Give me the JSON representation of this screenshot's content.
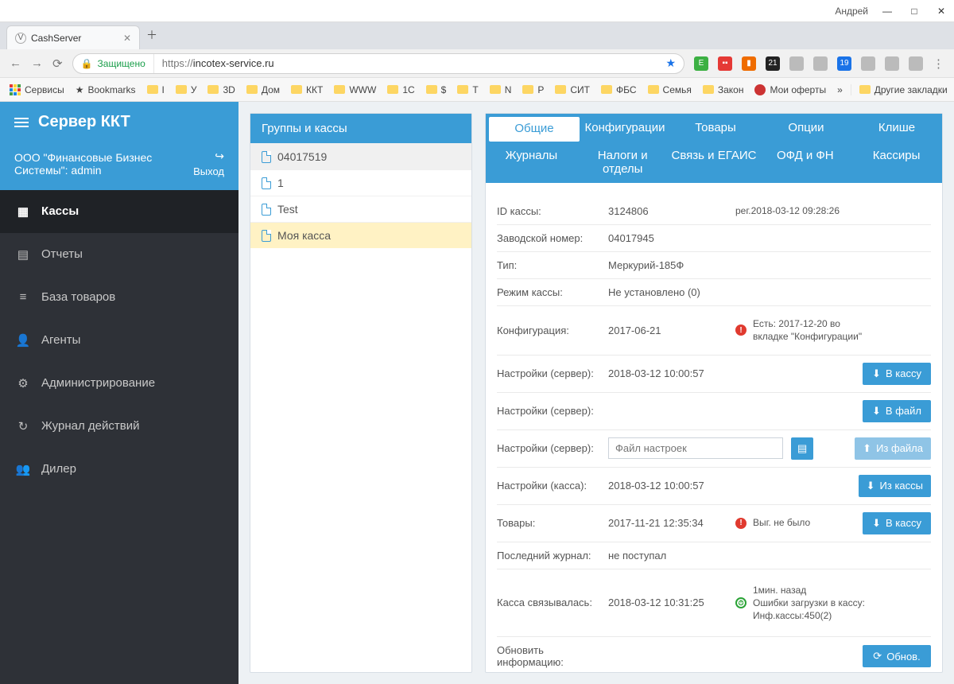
{
  "window": {
    "user": "Андрей"
  },
  "browser": {
    "tab_title": "CashServer",
    "secure_label": "Защищено",
    "url_proto": "https://",
    "url_host": "incotex-service.ru"
  },
  "bookmarks": {
    "services": "Сервисы",
    "bookmarks": "Bookmarks",
    "items": [
      "I",
      "У",
      "3D",
      "Дом",
      "ККТ",
      "WWW",
      "1C",
      "$",
      "T",
      "N",
      "P",
      "СИТ",
      "ФБС",
      "Семья",
      "Закон"
    ],
    "moi_oferty": "Мои оферты",
    "more": "»",
    "other": "Другие закладки"
  },
  "sidebar": {
    "title": "Сервер ККТ",
    "org": "ООО \"Финансовые Бизнес Системы\": admin",
    "logout": "Выход",
    "items": [
      {
        "label": "Кассы"
      },
      {
        "label": "Отчеты"
      },
      {
        "label": "База товаров"
      },
      {
        "label": "Агенты"
      },
      {
        "label": "Администрирование"
      },
      {
        "label": "Журнал действий"
      },
      {
        "label": "Дилер"
      }
    ]
  },
  "groups": {
    "title": "Группы и кассы",
    "items": [
      "04017519",
      "1",
      "Test",
      "Моя касса"
    ]
  },
  "tabs": {
    "row1": [
      "Общие",
      "Конфигурации",
      "Товары",
      "Опции",
      "Клише"
    ],
    "row2": [
      "Журналы",
      "Налоги и отделы",
      "Связь и ЕГАИС",
      "ОФД и ФН",
      "Кассиры"
    ]
  },
  "details": {
    "id_label": "ID кассы:",
    "id_value": "3124806",
    "reg_label": "рег.2018-03-12 09:28:26",
    "factory_label": "Заводской номер:",
    "factory_value": "04017945",
    "type_label": "Тип:",
    "type_value": "Меркурий-185Ф",
    "mode_label": "Режим кассы:",
    "mode_value": "Не установлено (0)",
    "config_label": "Конфигурация:",
    "config_value": "2017-06-21",
    "config_note": "Есть: 2017-12-20 во вкладке \"Конфигурации\"",
    "settings_srv_label": "Настройки (сервер):",
    "settings_srv_value": "2018-03-12 10:00:57",
    "settings_file_placeholder": "Файл настроек",
    "settings_kassa_label": "Настройки (касса):",
    "settings_kassa_value": "2018-03-12 10:00:57",
    "goods_label": "Товары:",
    "goods_value": "2017-11-21 12:35:34",
    "goods_note": "Выг. не было",
    "journal_label": "Последний журнал:",
    "journal_value": "не поступал",
    "conn_label": "Касса связывалась:",
    "conn_value": "2018-03-12 10:31:25",
    "conn_note": "1мин. назад\nОшибки загрузки в кассу:\nИнф.кассы:450(2)",
    "refresh_label": "Обновить информацию:"
  },
  "buttons": {
    "to_kassa": "В кассу",
    "to_file": "В файл",
    "from_file": "Из файла",
    "from_kassa": "Из кассы",
    "refresh": "Обнов."
  }
}
